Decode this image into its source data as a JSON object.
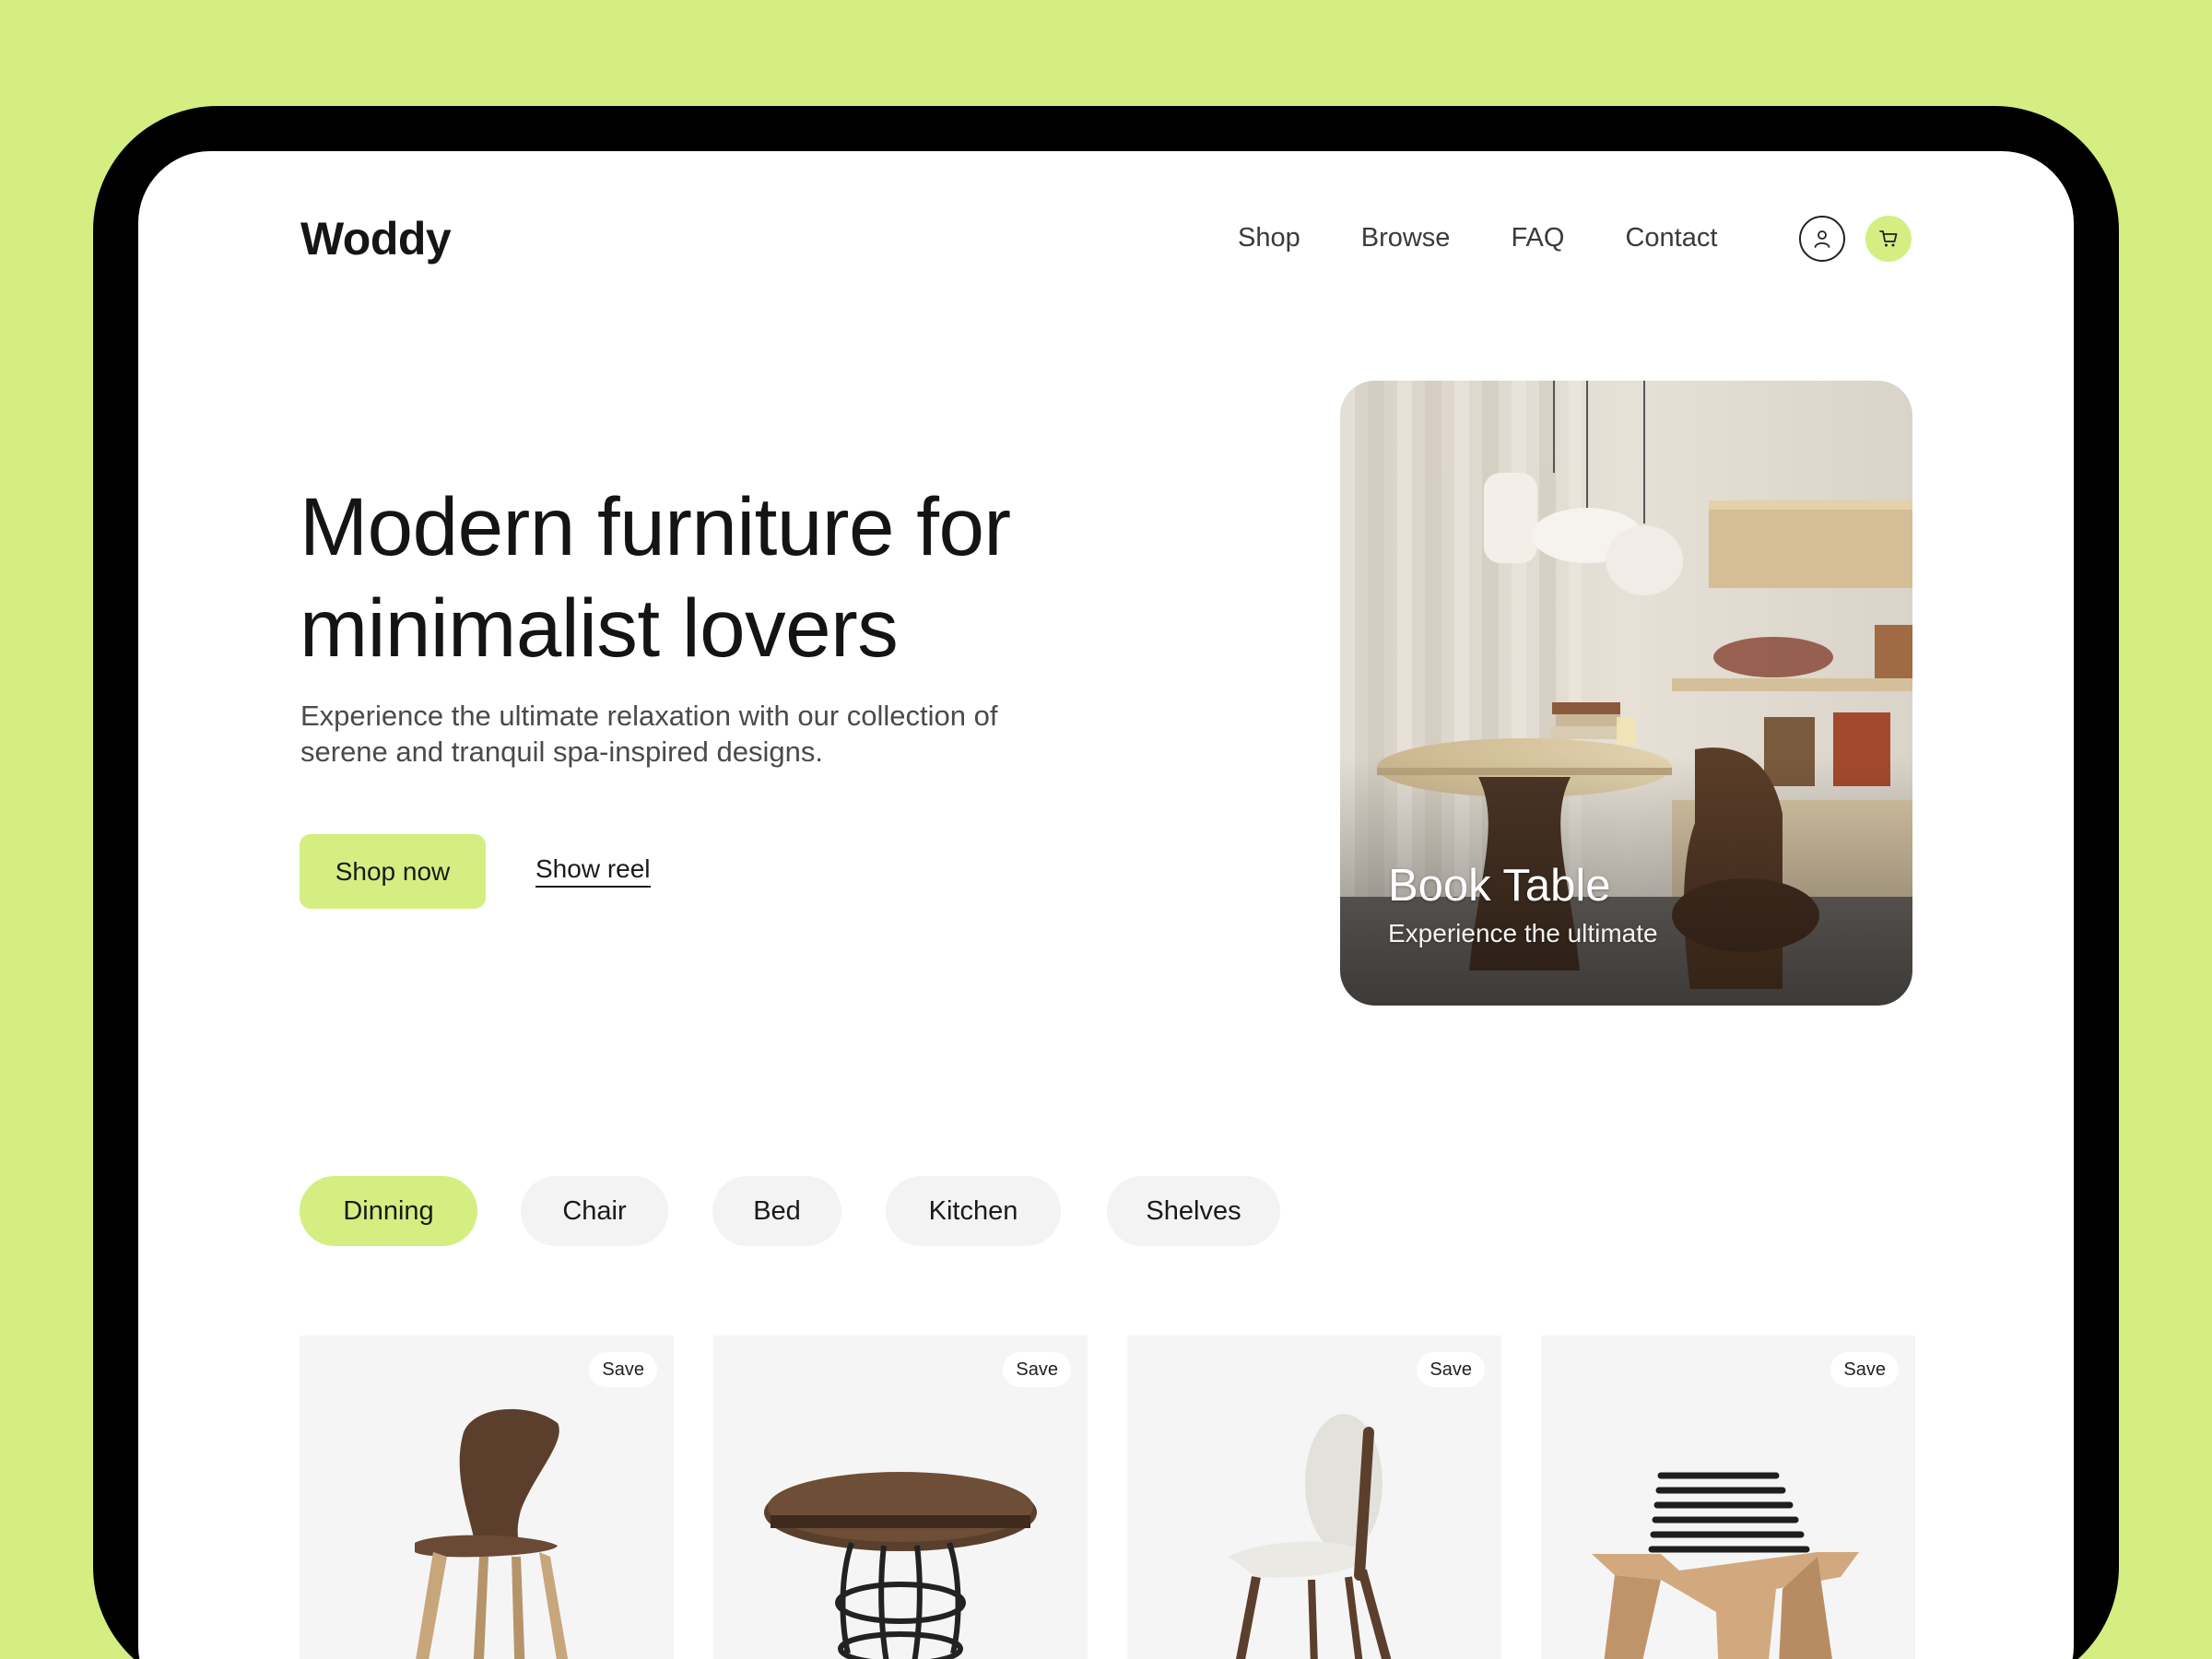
{
  "brand": {
    "name": "Woddy"
  },
  "nav": {
    "items": [
      "Shop",
      "Browse",
      "FAQ",
      "Contact"
    ]
  },
  "hero": {
    "title_line1": "Modern furniture for",
    "title_line2": "minimalist lovers",
    "subtitle_line1": "Experience the ultimate relaxation with our collection of",
    "subtitle_line2": "serene and tranquil spa-inspired designs.",
    "primary_cta": "Shop now",
    "secondary_cta": "Show reel"
  },
  "featured": {
    "title": "Book Table",
    "subtitle": "Experience the ultimate"
  },
  "categories": {
    "active": "Dinning",
    "items": [
      "Dinning",
      "Chair",
      "Bed",
      "Kitchen",
      "Shelves"
    ]
  },
  "products": [
    {
      "save_label": "Save",
      "image": "bentwood-chair"
    },
    {
      "save_label": "Save",
      "image": "round-table"
    },
    {
      "save_label": "Save",
      "image": "upholstered-chair"
    },
    {
      "save_label": "Save",
      "image": "slatted-lounger"
    }
  ],
  "colors": {
    "accent": "#d4ee82",
    "text": "#141414",
    "chip": "#f4f3f3",
    "card": "#f5f5f5"
  },
  "icons": {
    "user": "user-icon",
    "cart": "cart-icon"
  }
}
